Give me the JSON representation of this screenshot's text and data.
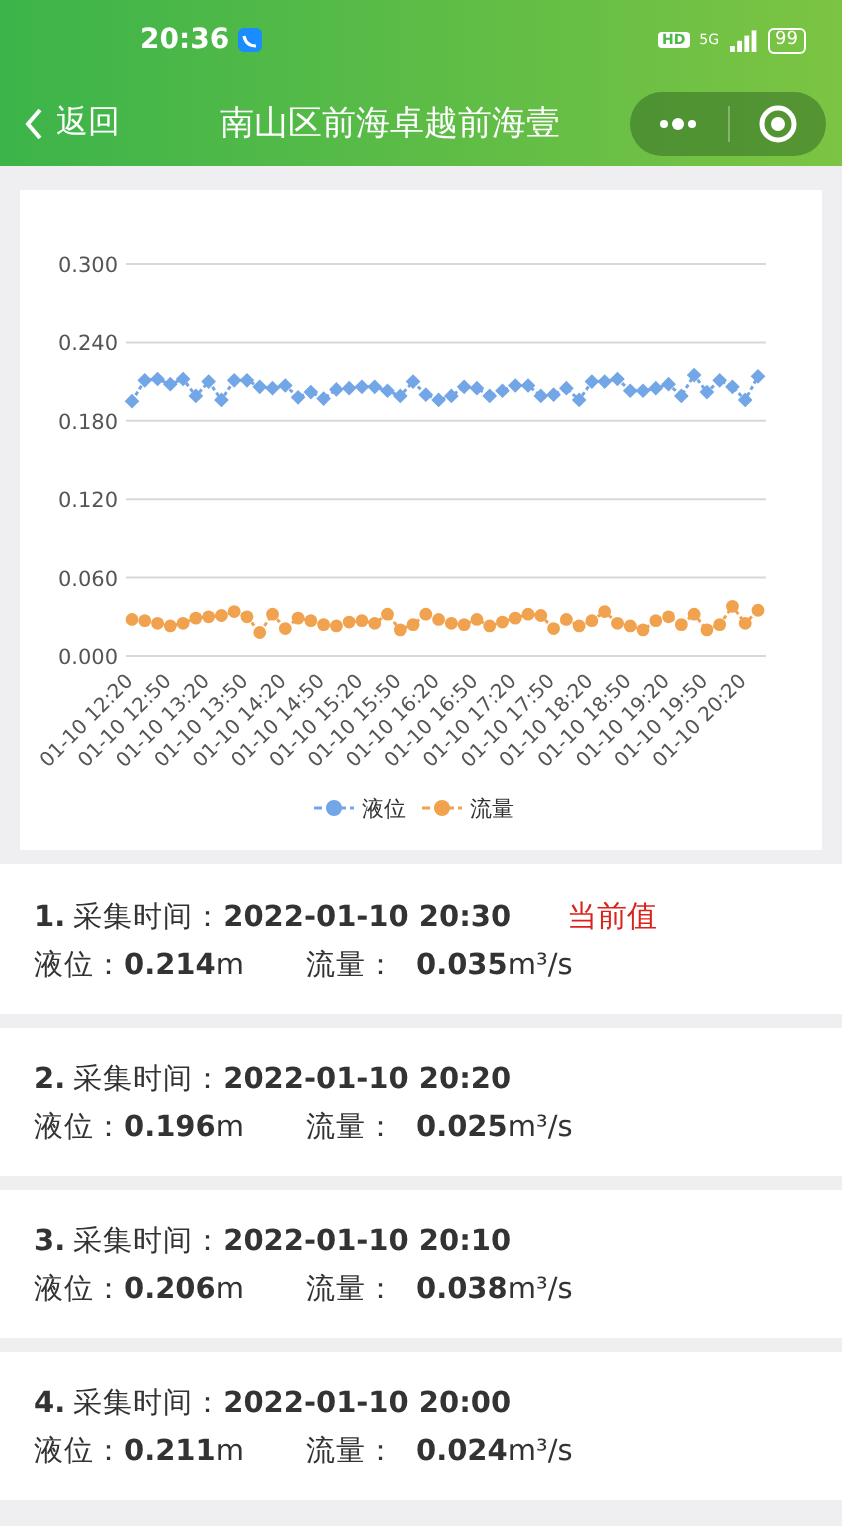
{
  "status_bar": {
    "time": "20:36",
    "hd": "HD",
    "network": "5G",
    "battery": "99"
  },
  "header": {
    "back": "返回",
    "title": "南山区前海卓越前海壹"
  },
  "chart": {
    "chart_data": {
      "type": "line",
      "ylim": [
        0,
        0.3
      ],
      "yticks": [
        {
          "value": 0,
          "label": "0.000"
        },
        {
          "value": 0.06,
          "label": "0.060"
        },
        {
          "value": 0.12,
          "label": "0.120"
        },
        {
          "value": 0.18,
          "label": "0.180"
        },
        {
          "value": 0.24,
          "label": "0.240"
        },
        {
          "value": 0.3,
          "label": "0.300"
        }
      ],
      "grid": true,
      "legend": "bottom",
      "categories": [
        "01-10 12:20",
        null,
        null,
        "01-10 12:50",
        null,
        null,
        "01-10 13:20",
        null,
        null,
        "01-10 13:50",
        null,
        null,
        "01-10 14:20",
        null,
        null,
        "01-10 14:50",
        null,
        null,
        "01-10 15:20",
        null,
        null,
        "01-10 15:50",
        null,
        null,
        "01-10 16:20",
        null,
        null,
        "01-10 16:50",
        null,
        null,
        "01-10 17:20",
        null,
        null,
        "01-10 17:50",
        null,
        null,
        "01-10 18:20",
        null,
        null,
        "01-10 18:50",
        null,
        null,
        "01-10 19:20",
        null,
        null,
        "01-10 19:50",
        null,
        null,
        "01-10 20:20",
        null
      ],
      "series": [
        {
          "name": "液位",
          "color": "#73a6e6",
          "line_style": "dashed",
          "marker": "diamond",
          "values": [
            0.195,
            0.211,
            0.212,
            0.208,
            0.212,
            0.199,
            0.21,
            0.196,
            0.211,
            0.211,
            0.206,
            0.205,
            0.207,
            0.198,
            0.202,
            0.197,
            0.204,
            0.205,
            0.206,
            0.206,
            0.203,
            0.199,
            0.21,
            0.2,
            0.196,
            0.199,
            0.206,
            0.205,
            0.199,
            0.203,
            0.207,
            0.207,
            0.199,
            0.2,
            0.205,
            0.196,
            0.21,
            0.21,
            0.212,
            0.203,
            0.203,
            0.205,
            0.208,
            0.199,
            0.215,
            0.202,
            0.211,
            0.206,
            0.196,
            0.214
          ]
        },
        {
          "name": "流量",
          "color": "#f0a24e",
          "line_style": "dashed",
          "marker": "circle",
          "values": [
            0.028,
            0.027,
            0.025,
            0.023,
            0.025,
            0.029,
            0.03,
            0.031,
            0.034,
            0.03,
            0.018,
            0.032,
            0.021,
            0.029,
            0.027,
            0.024,
            0.023,
            0.026,
            0.027,
            0.025,
            0.032,
            0.02,
            0.024,
            0.032,
            0.028,
            0.025,
            0.024,
            0.028,
            0.023,
            0.026,
            0.029,
            0.032,
            0.031,
            0.021,
            0.028,
            0.023,
            0.027,
            0.034,
            0.025,
            0.023,
            0.02,
            0.027,
            0.03,
            0.024,
            0.032,
            0.02,
            0.024,
            0.038,
            0.025,
            0.035
          ]
        }
      ]
    }
  },
  "records": [
    {
      "index": "1.",
      "time_label": "采集时间：",
      "time": "2022-01-10 20:30",
      "badge": "当前值",
      "level_label": "液位：",
      "level_value": "0.214",
      "level_unit": "m",
      "flow_label": "流量：",
      "flow_value": "0.035",
      "flow_unit": "m³/s"
    },
    {
      "index": "2.",
      "time_label": "采集时间：",
      "time": "2022-01-10 20:20",
      "level_label": "液位：",
      "level_value": "0.196",
      "level_unit": "m",
      "flow_label": "流量：",
      "flow_value": "0.025",
      "flow_unit": "m³/s"
    },
    {
      "index": "3.",
      "time_label": "采集时间：",
      "time": "2022-01-10 20:10",
      "level_label": "液位：",
      "level_value": "0.206",
      "level_unit": "m",
      "flow_label": "流量：",
      "flow_value": "0.038",
      "flow_unit": "m³/s"
    },
    {
      "index": "4.",
      "time_label": "采集时间：",
      "time": "2022-01-10 20:00",
      "level_label": "液位：",
      "level_value": "0.211",
      "level_unit": "m",
      "flow_label": "流量：",
      "flow_value": "0.024",
      "flow_unit": "m³/s"
    }
  ]
}
